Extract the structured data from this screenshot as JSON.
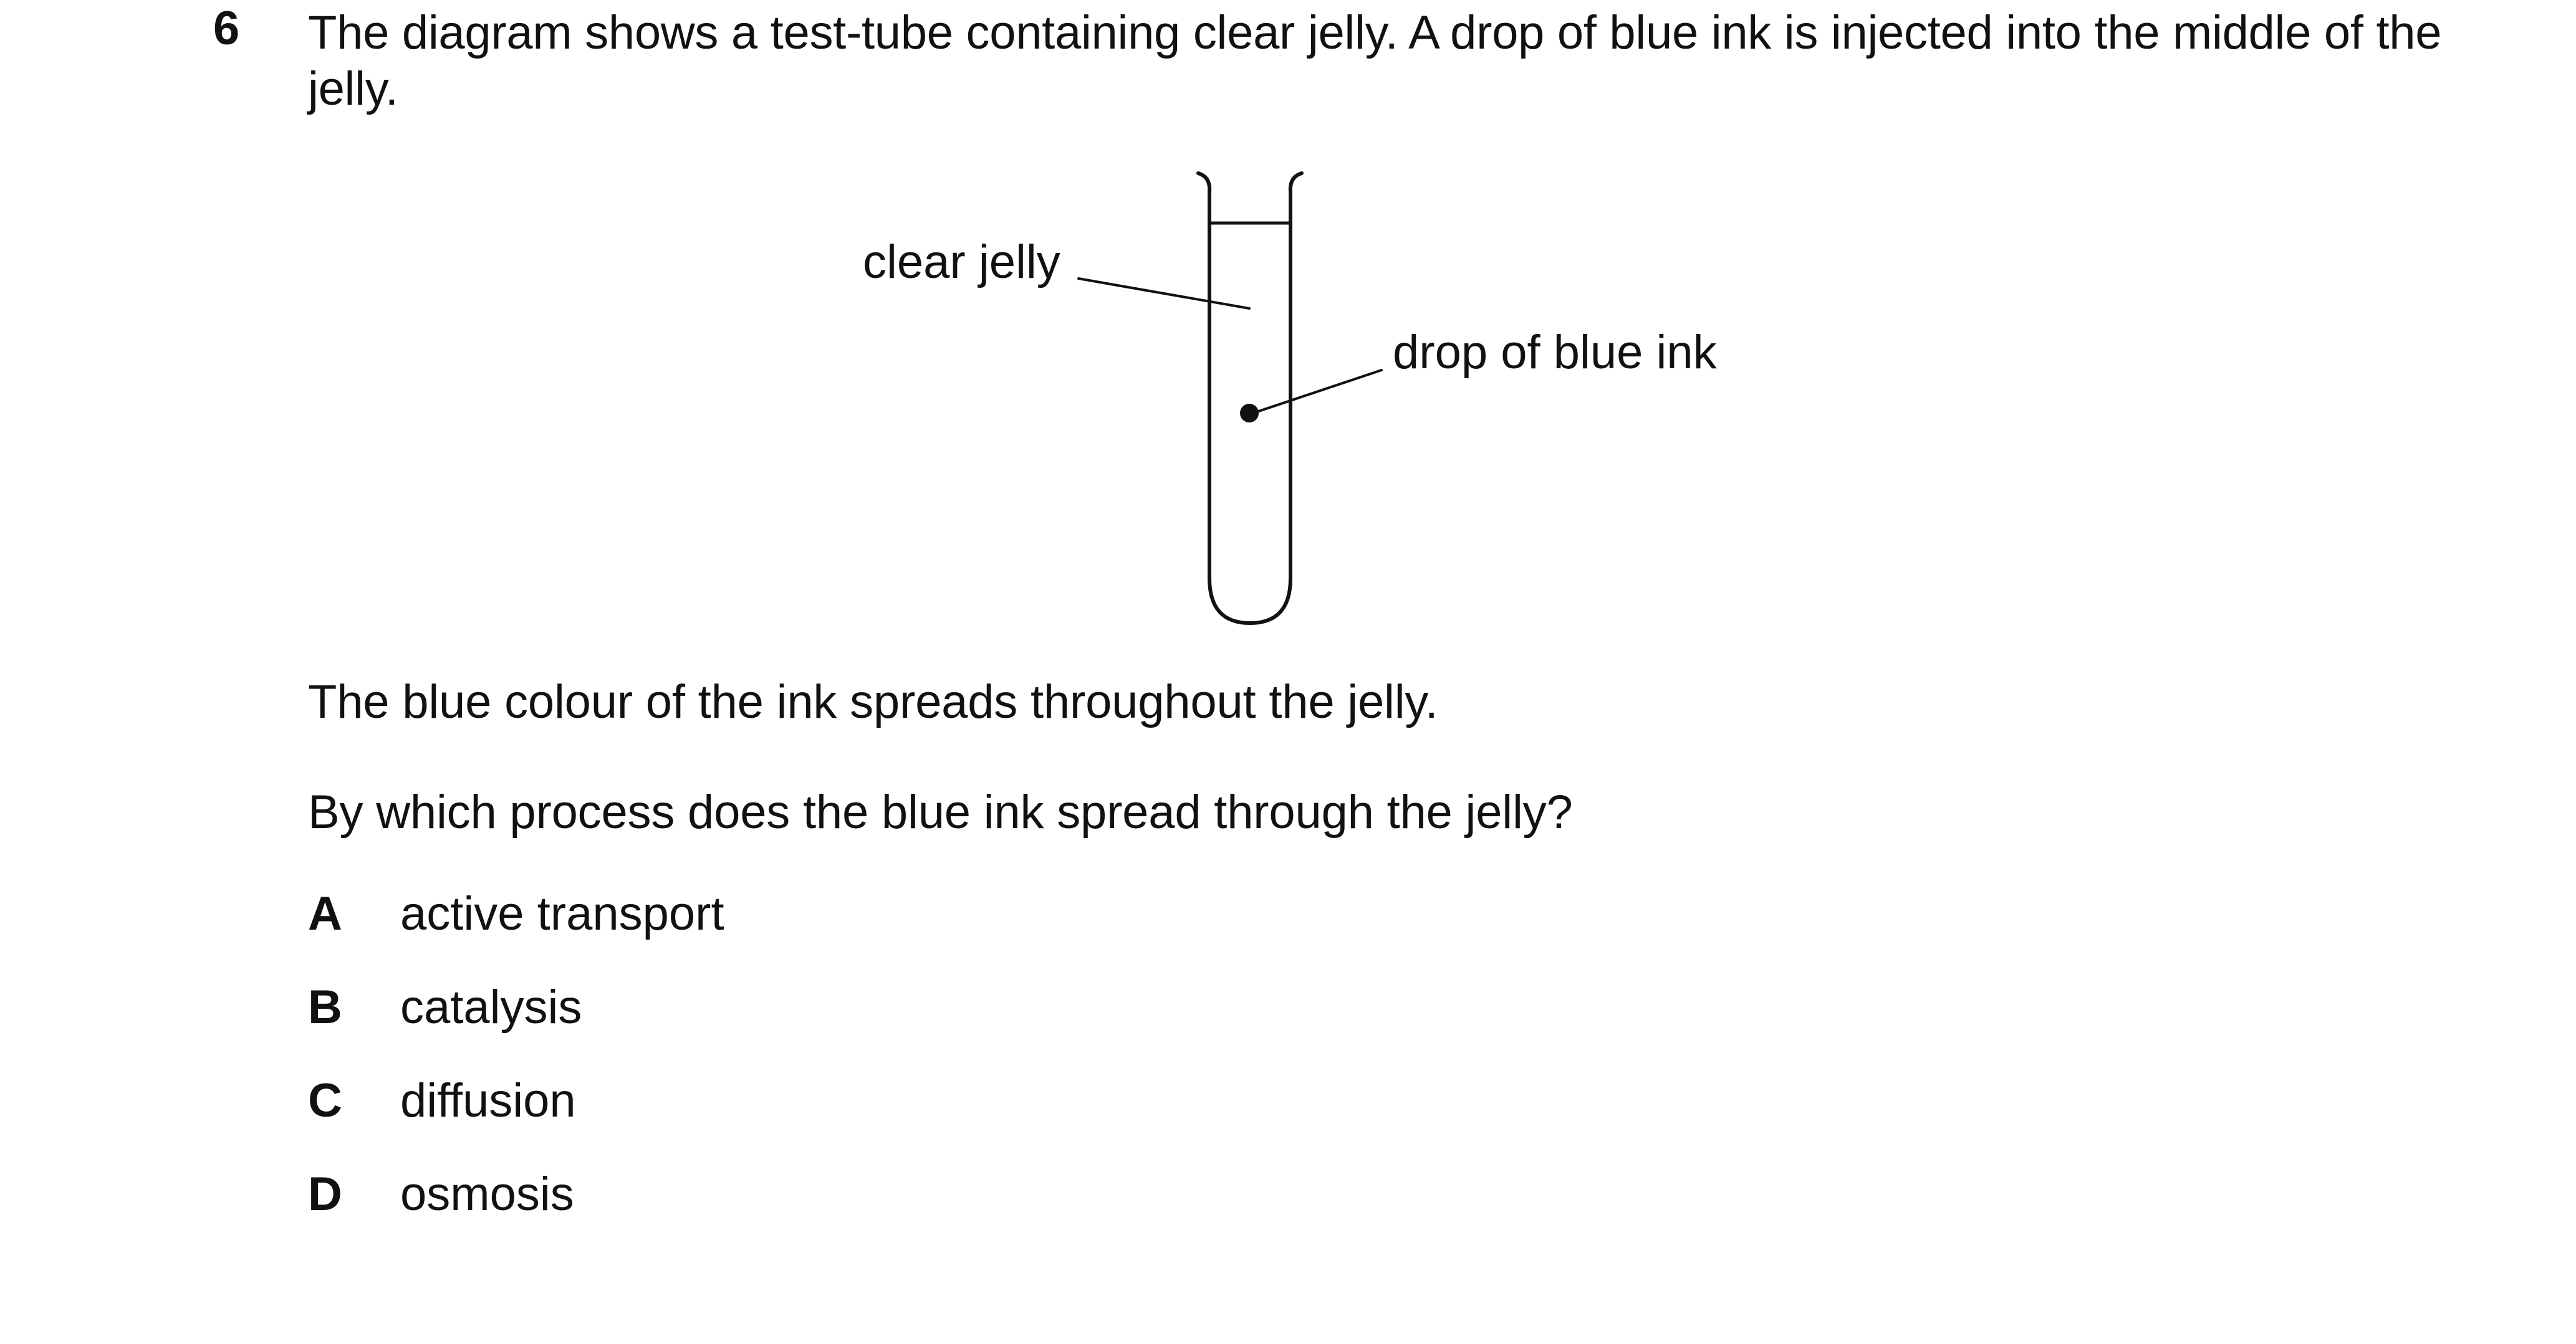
{
  "question": {
    "number": "6",
    "stem": "The diagram shows a test-tube containing clear jelly. A drop of blue ink is injected into the middle of the jelly."
  },
  "diagram": {
    "labels": {
      "clear_jelly": "clear jelly",
      "drop_of_blue_ink": "drop of blue ink"
    }
  },
  "text": {
    "line1": "The blue colour of the ink spreads throughout the jelly.",
    "line2": "By which process does the blue ink spread through the jelly?"
  },
  "options": [
    {
      "letter": "A",
      "text": "active transport"
    },
    {
      "letter": "B",
      "text": "catalysis"
    },
    {
      "letter": "C",
      "text": "diffusion"
    },
    {
      "letter": "D",
      "text": "osmosis"
    }
  ]
}
